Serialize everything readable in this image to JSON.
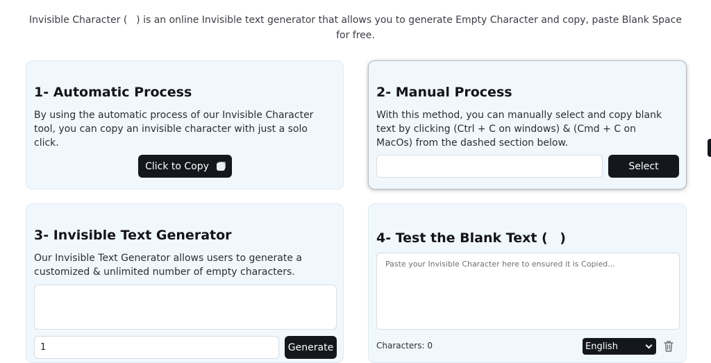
{
  "intro": {
    "line1": "Invisible Character (ㅤ) is an online Invisible text generator that allows you to generate Empty Character and copy, paste Blank Space",
    "line2": "for free."
  },
  "card1": {
    "title": "1- Automatic Process",
    "desc_lines": [
      "By using the automatic process of our Invisible Character",
      "tool, you can copy an invisible character with just a solo",
      "click."
    ],
    "button_label": "Click to Copy",
    "button_icon": "copy-icon"
  },
  "card2": {
    "title": "2- Manual Process",
    "desc_lines": [
      "With this method, you can manually select and copy blank",
      "text by clicking (Ctrl + C on windows) & (Cmd + C on",
      "MacOs) from the dashed section below."
    ],
    "field_value": "",
    "button_label": "Select"
  },
  "card3": {
    "title": "3- Invisible Text Generator",
    "desc_lines": [
      "Our Invisible Text Generator allows users to generate a",
      "customized & unlimited number of empty characters."
    ],
    "output_value": "",
    "count_value": "1",
    "button_label": "Generate"
  },
  "card4": {
    "title": "4- Test the Blank Text (ㅤ)",
    "textarea_placeholder": "Paste your Invisible Character here to ensured it is Copied...",
    "char_count_label": "Characters: 0",
    "language_selected": "English",
    "trash_icon": "trash-icon"
  },
  "colors": {
    "card_bg": "#f1f8fd",
    "button_dark": "#14171c"
  }
}
